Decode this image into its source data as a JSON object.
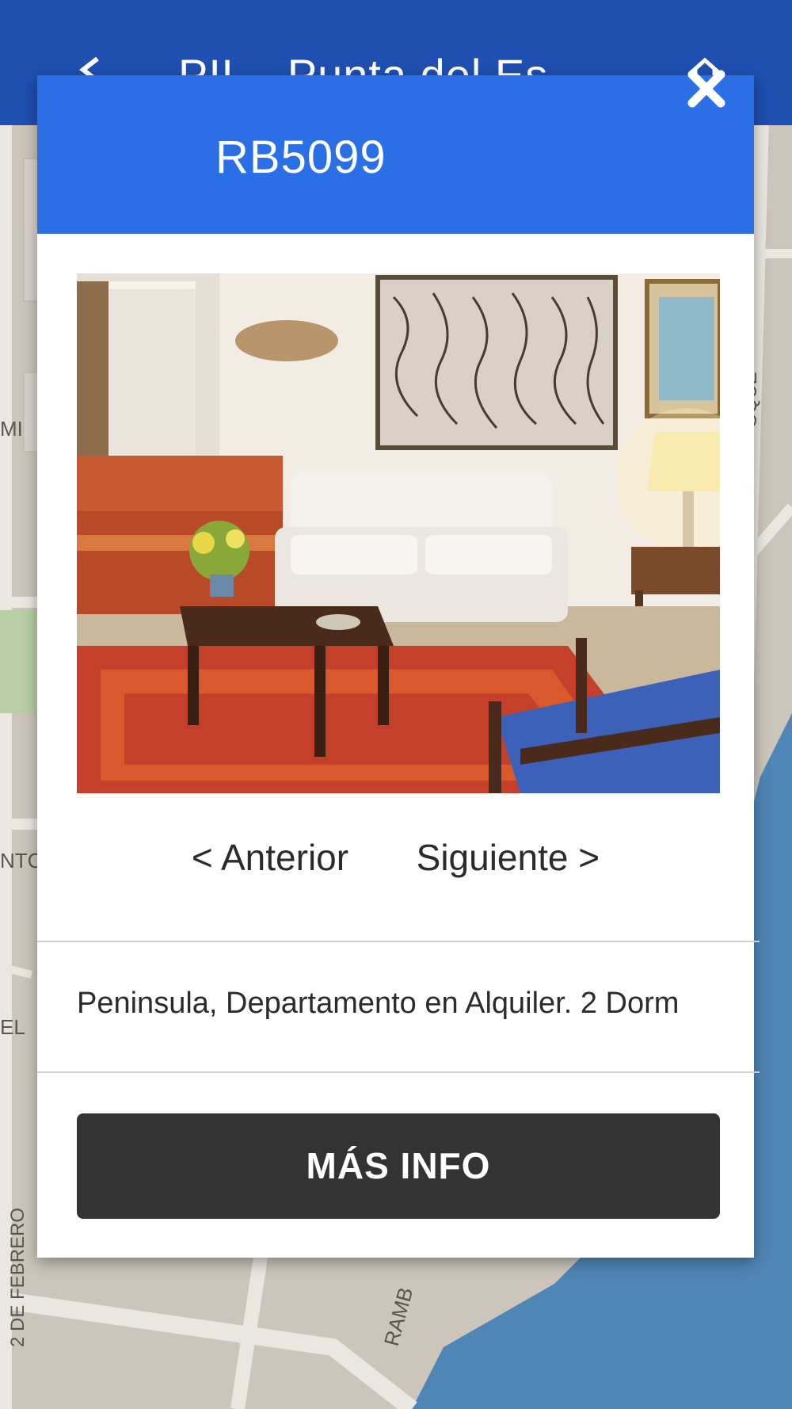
{
  "app_bar": {
    "title": "PIL - Punta del Es",
    "back_icon": "back-arrow-icon",
    "home_icon": "home-icon"
  },
  "map": {
    "street_labels": [
      "MI",
      "NTC",
      "EL",
      "2 DE FEBRERO",
      "RAMB",
      "OQUE"
    ]
  },
  "dialog": {
    "title": "RB5099",
    "close_icon": "close-icon",
    "photo": "living-room-photo",
    "nav": {
      "prev_label": "< Anterior",
      "next_label": "Siguiente >"
    },
    "description": "Peninsula, Departamento en Alquiler. 2 Dorm",
    "more_button_label": "MÁS INFO"
  },
  "colors": {
    "app_bar": "#1f4fb0",
    "dialog_header": "#2a6fe6",
    "button": "#333333",
    "water": "#4f86b6"
  }
}
